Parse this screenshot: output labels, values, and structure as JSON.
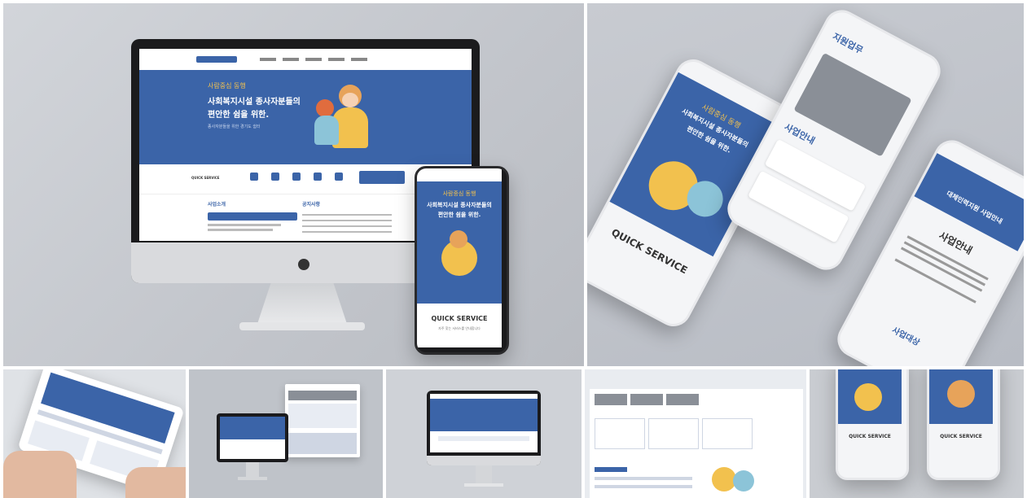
{
  "hero": {
    "slogan": "사람중심 동행",
    "headline_1": "사회복지시설 종사자분들의",
    "headline_2": "편안한 쉼을 위한.",
    "sub": "종사자분들을 위한 경기도 쉼터"
  },
  "quick": {
    "label": "QUICK SERVICE",
    "sub": "자주 찾는 서비스를 안내합니다"
  },
  "desktop_sections": {
    "left_title": "사업소개",
    "right_title": "공지사항"
  },
  "phone2": {
    "title": "지원업무",
    "section": "사업안내"
  },
  "phone3": {
    "banner": "대체인력지원 사업안내",
    "title": "사업안내",
    "footer_title": "사업대상"
  },
  "mini": {
    "quick": "QUICK SERVICE"
  },
  "colors": {
    "brand_blue": "#3b64a8",
    "accent_yellow": "#f2c14e"
  }
}
